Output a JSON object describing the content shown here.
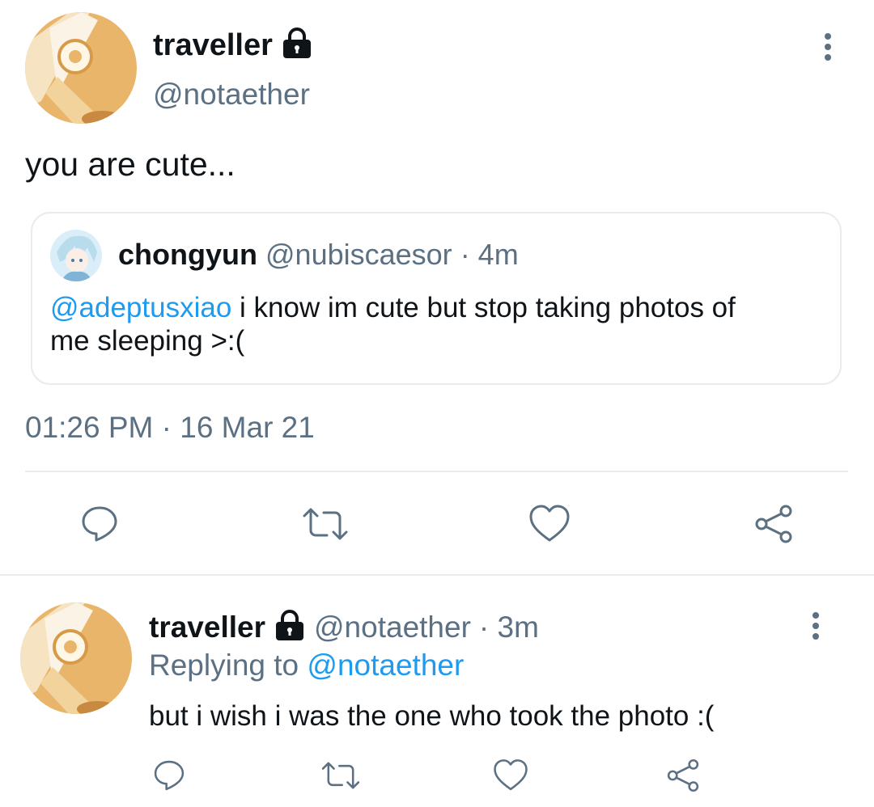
{
  "tweet": {
    "author": {
      "display_name": "traveller",
      "handle": "@notaether"
    },
    "text": "you are cute...",
    "quoted": {
      "display_name": "chongyun",
      "handle": "@nubiscaesor",
      "time_ago": "· 4m",
      "mention": "@adeptusxiao",
      "text_line1": " i know im cute but stop taking photos of",
      "text_line2": "me sleeping >:("
    },
    "timestamp": "01:26 PM · 16 Mar 21",
    "actions": [
      "reply-icon",
      "retweet-icon",
      "like-icon",
      "share-icon"
    ]
  },
  "reply": {
    "author": {
      "display_name": "traveller",
      "handle": "@notaether",
      "time_ago": "· 3m"
    },
    "replying_to_label": "Replying to",
    "replying_to_handle": "@notaether",
    "text": "but i wish i was the one who took the photo :(",
    "actions": [
      "reply-icon",
      "retweet-icon",
      "like-icon",
      "share-icon"
    ]
  },
  "colors": {
    "text": "#0f1419",
    "muted": "#5b7083",
    "link": "#1d9bf0",
    "divider": "#e6ecf0"
  }
}
